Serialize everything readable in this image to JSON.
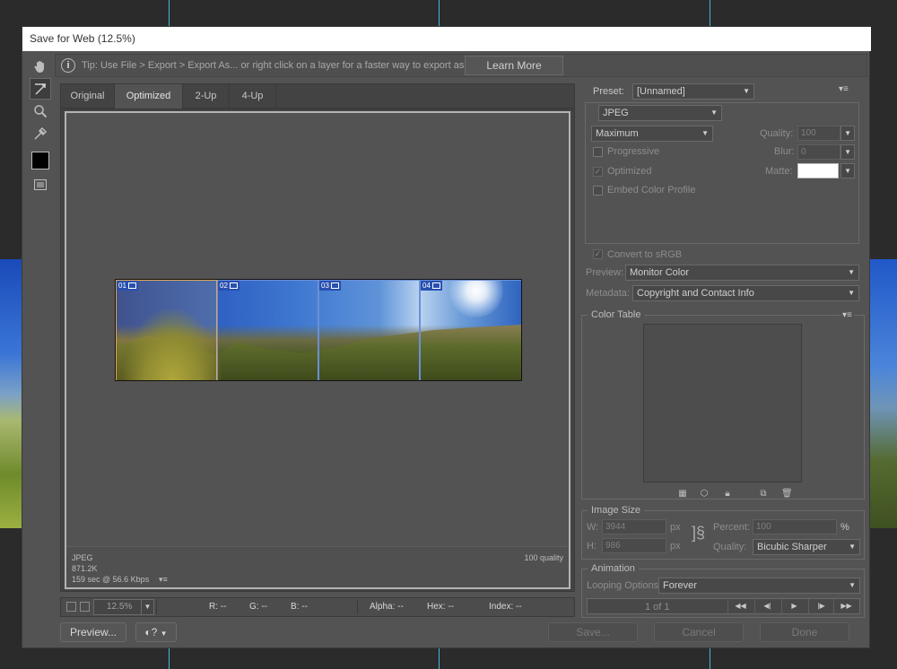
{
  "window_title": "Save for Web (12.5%)",
  "tip": {
    "text": "Tip: Use File > Export > Export As...  or right click on a layer for a faster way to export assets",
    "learn_more": "Learn More"
  },
  "tools": [
    "hand-icon",
    "slice-select-icon",
    "zoom-icon",
    "eyedropper-icon"
  ],
  "view_tabs": [
    {
      "label": "Original"
    },
    {
      "label": "Optimized"
    },
    {
      "label": "2-Up"
    },
    {
      "label": "4-Up"
    }
  ],
  "canvas": {
    "slices": [
      "01",
      "02",
      "03",
      "04"
    ],
    "status": {
      "format": "JPEG",
      "size": "871.2K",
      "time": "159 sec @ 56.6 Kbps",
      "quality": "100 quality",
      "menu": "▾≡"
    }
  },
  "bottom_bar": {
    "zoom": "12.5%",
    "r": "R: --",
    "g": "G: --",
    "b": "B: --",
    "alpha": "Alpha: --",
    "hex": "Hex: --",
    "index": "Index: --"
  },
  "footer": {
    "preview": "Preview...",
    "save": "Save...",
    "cancel": "Cancel",
    "done": "Done"
  },
  "settings": {
    "preset_label": "Preset:",
    "preset_value": "[Unnamed]",
    "format": "JPEG",
    "compression": "Maximum",
    "quality_label": "Quality:",
    "quality_value": "100",
    "blur_label": "Blur:",
    "blur_value": "0",
    "matte_label": "Matte:",
    "matte_color": "#ffffff",
    "progressive": "Progressive",
    "optimized": "Optimized",
    "embed_profile": "Embed Color Profile",
    "convert_srgb": "Convert to sRGB",
    "preview_label": "Preview:",
    "preview_value": "Monitor Color",
    "metadata_label": "Metadata:",
    "metadata_value": "Copyright and Contact Info"
  },
  "color_table": {
    "title": "Color Table"
  },
  "image_size": {
    "title": "Image Size",
    "w_label": "W:",
    "w_value": "3944",
    "h_label": "H:",
    "h_value": "986",
    "unit": "px",
    "percent_label": "Percent:",
    "percent_value": "100",
    "percent_unit": "%",
    "quality_label": "Quality:",
    "quality_value": "Bicubic Sharper"
  },
  "animation": {
    "title": "Animation",
    "looping_label": "Looping Options:",
    "looping_value": "Forever",
    "frame_counter": "1 of 1"
  }
}
